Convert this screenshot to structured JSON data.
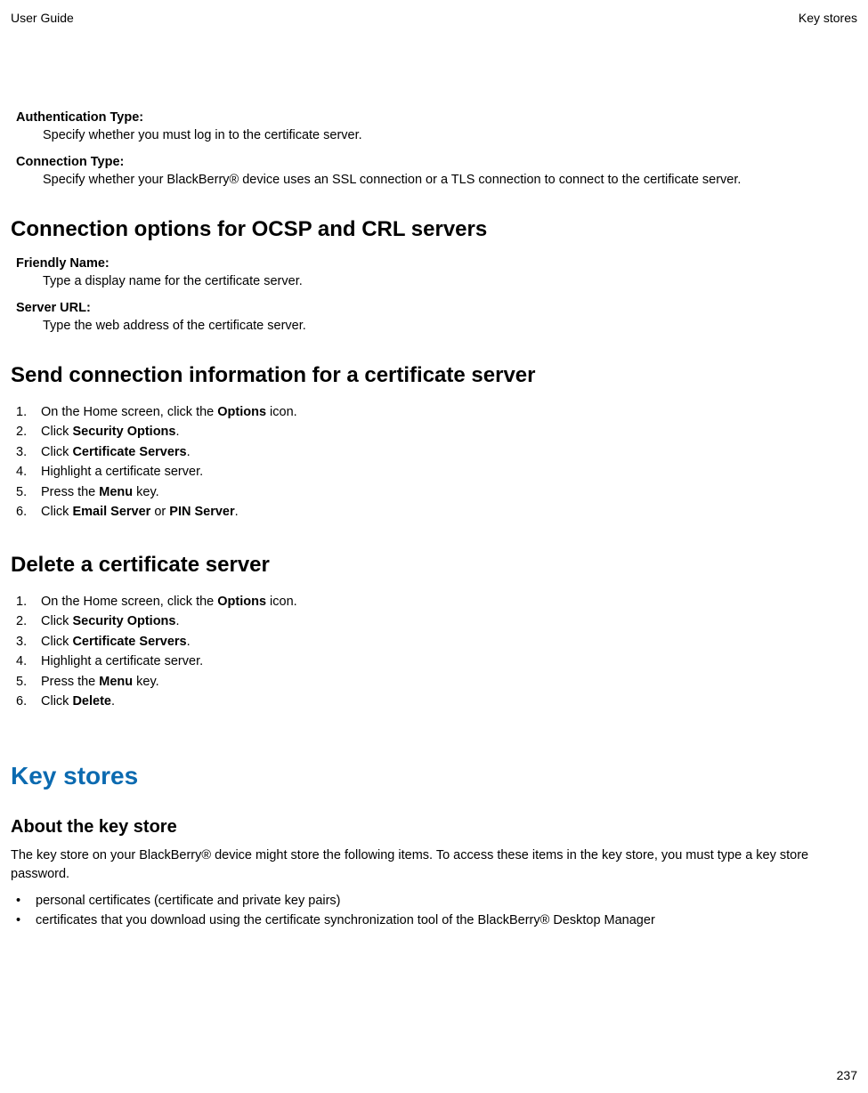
{
  "header": {
    "left": "User Guide",
    "right": "Key stores"
  },
  "defs1": [
    {
      "term": "Authentication Type:",
      "desc": "Specify whether you must log in to the certificate server."
    },
    {
      "term": "Connection Type:",
      "desc": "Specify whether your BlackBerry® device uses an SSL connection or a TLS connection to connect to the certificate server."
    }
  ],
  "h2_ocsp": "Connection options for OCSP and CRL servers",
  "defs2": [
    {
      "term": "Friendly Name:",
      "desc": "Type a display name for the certificate server."
    },
    {
      "term": "Server URL:",
      "desc": "Type the web address of the certificate server."
    }
  ],
  "h2_send": "Send connection information for a certificate server",
  "send_steps": {
    "s1a": "On the Home screen, click the ",
    "s1b": "Options",
    "s1c": " icon.",
    "s2a": "Click ",
    "s2b": "Security Options",
    "s2c": ".",
    "s3a": "Click ",
    "s3b": "Certificate Servers",
    "s3c": ".",
    "s4": "Highlight a certificate server.",
    "s5a": "Press the ",
    "s5b": "Menu",
    "s5c": " key.",
    "s6a": "Click ",
    "s6b": "Email Server",
    "s6c": " or ",
    "s6d": "PIN Server",
    "s6e": "."
  },
  "h2_delete": "Delete a certificate server",
  "delete_steps": {
    "s1a": "On the Home screen, click the ",
    "s1b": "Options",
    "s1c": " icon.",
    "s2a": "Click ",
    "s2b": "Security Options",
    "s2c": ".",
    "s3a": "Click ",
    "s3b": "Certificate Servers",
    "s3c": ".",
    "s4": "Highlight a certificate server.",
    "s5a": "Press the ",
    "s5b": "Menu",
    "s5c": " key.",
    "s6a": "Click ",
    "s6b": "Delete",
    "s6c": "."
  },
  "h1_keystores": "Key stores",
  "h3_about": "About the key store",
  "about_para": "The key store on your BlackBerry® device might store the following items. To access these items in the key store, you must type a key store password.",
  "bullets": [
    "personal certificates (certificate and private key pairs)",
    "certificates that you download using the certificate synchronization tool of the BlackBerry® Desktop Manager"
  ],
  "page_number": "237"
}
